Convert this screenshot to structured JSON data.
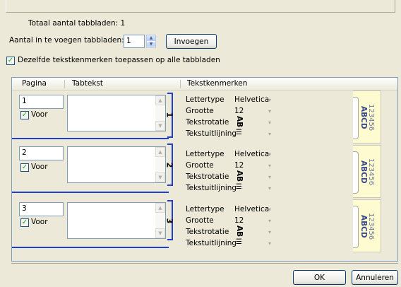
{
  "total_label": "Totaal aantal tabbladen:",
  "total_value": "1",
  "insert_count_label": "Aantal in te voegen tabbladen:",
  "insert_count_value": "1",
  "insert_button": "Invoegen",
  "same_props_label": "Dezelfde tekstkenmerken toepassen op alle tabbladen",
  "same_props_checked": true,
  "columns": [
    "Pagina",
    "Tabtekst",
    "Tekstkenmerken"
  ],
  "rows": [
    {
      "page": "1",
      "voor": "Voor",
      "tabnum": "1"
    },
    {
      "page": "2",
      "voor": "Voor",
      "tabnum": "2"
    },
    {
      "page": "3",
      "voor": "Voor",
      "tabnum": "3"
    }
  ],
  "props": {
    "font_label": "Lettertype",
    "font_value": "Helvetica",
    "size_label": "Grootte",
    "size_value": "12",
    "rotation_label": "Tekstrotatie",
    "rotation_value": "AB",
    "align_label": "Tekstuitlijning"
  },
  "preview": {
    "line1": "ABCD",
    "line2": "123456"
  },
  "ok_button": "OK",
  "cancel_button": "Annuleren",
  "colors": {
    "accent_blue": "#1e3fd1",
    "preview_bg": "#fffbd0",
    "dialog_bg": "#ece9d8"
  }
}
